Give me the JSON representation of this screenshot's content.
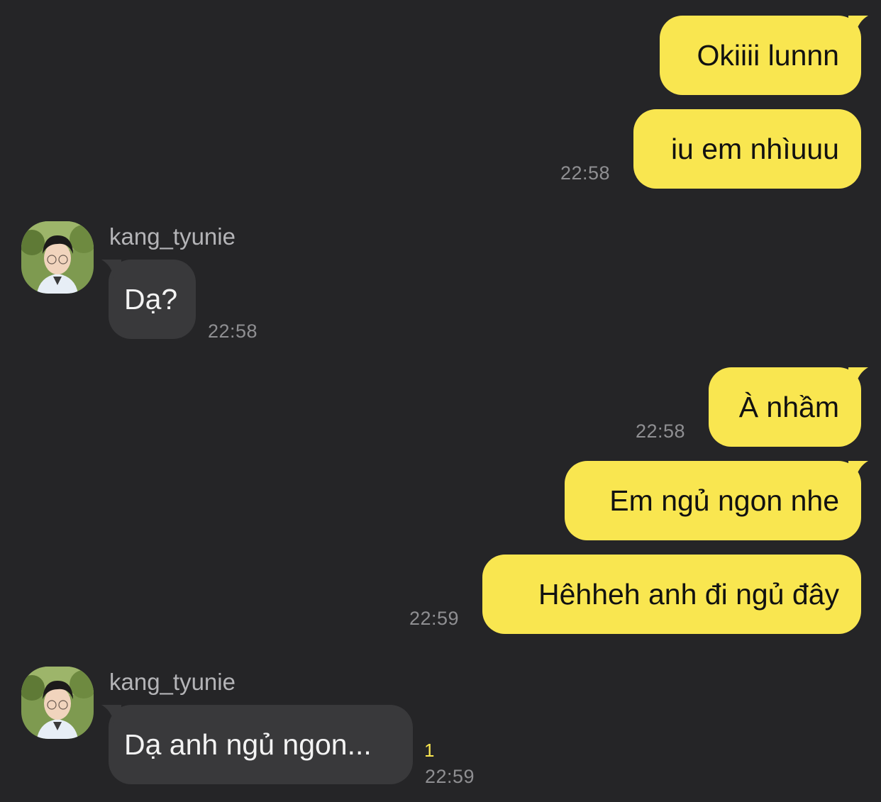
{
  "colors": {
    "background": "#252527",
    "outgoing_bubble": "#f9e650",
    "incoming_bubble": "#39393b",
    "timestamp": "#8f8f92",
    "unread_count": "#f9e650"
  },
  "messages": {
    "m1": {
      "text": "Okiiii lunnn"
    },
    "m2": {
      "text": "iu em nhìuuu",
      "time": "22:58"
    },
    "m3": {
      "sender": "kang_tyunie",
      "avatar": "profile-photo",
      "text": "Dạ?",
      "time": "22:58"
    },
    "m4": {
      "text": "À nhầm",
      "time": "22:58"
    },
    "m5": {
      "text": "Em ngủ ngon nhe"
    },
    "m6": {
      "text": "Hêhheh anh đi ngủ đây",
      "time": "22:59"
    },
    "m7": {
      "sender": "kang_tyunie",
      "avatar": "profile-photo",
      "text": "Dạ anh ngủ ngon...",
      "unread": "1",
      "time": "22:59"
    }
  }
}
